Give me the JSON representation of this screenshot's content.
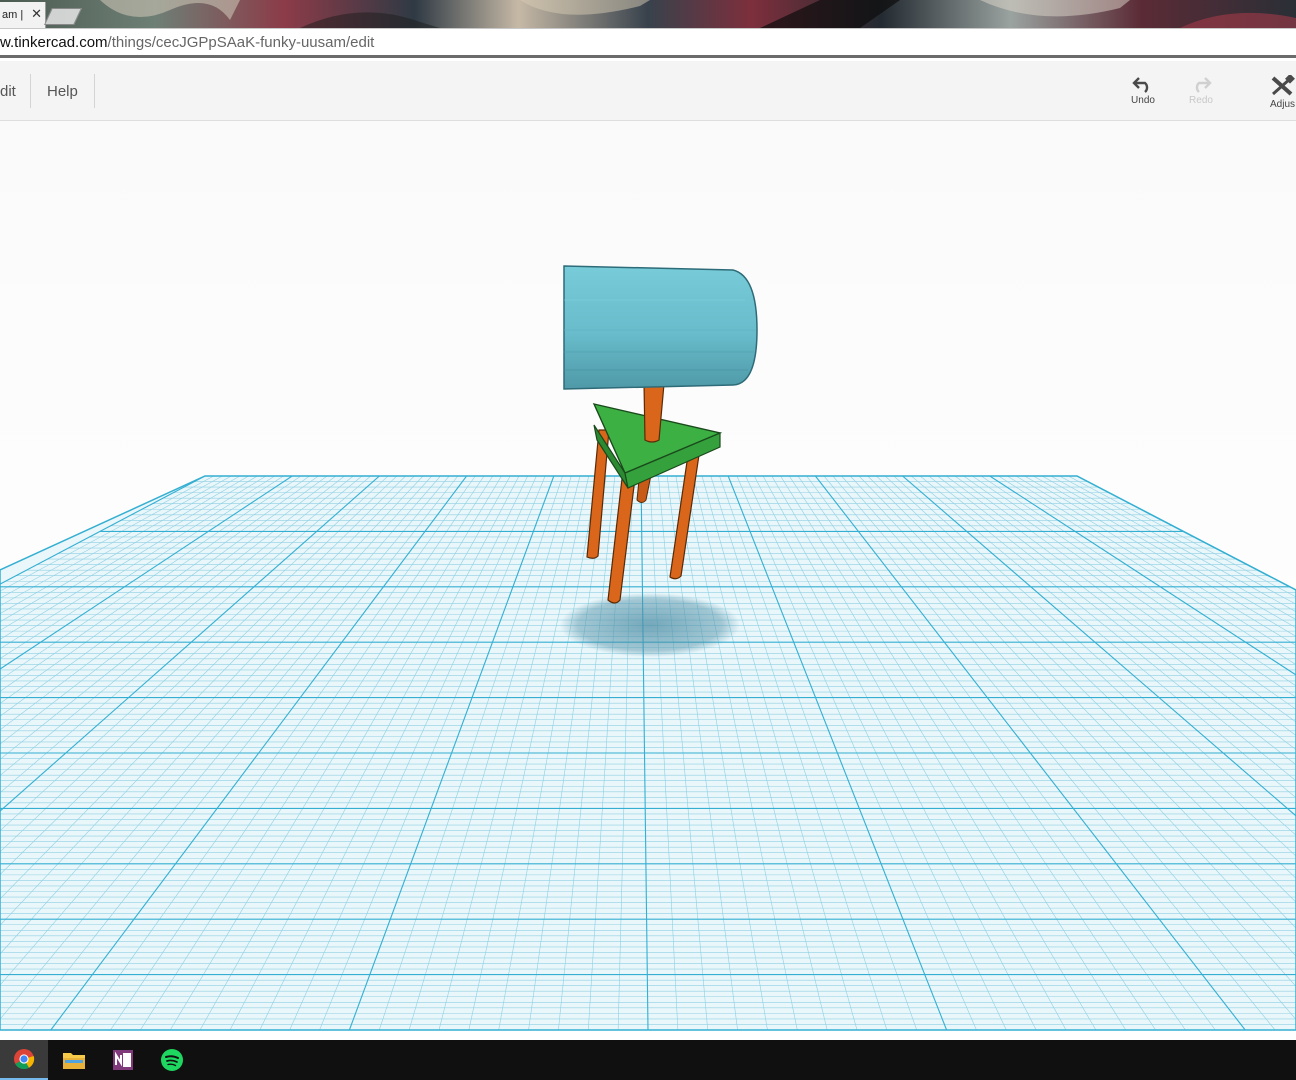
{
  "browser": {
    "tab": {
      "title": "am |",
      "close_glyph": "✕"
    },
    "address": {
      "domain": "w.tinkercad.com",
      "path": "/things/cecJGPpSAaK-funky-uusam/edit"
    }
  },
  "toolbar": {
    "menu": [
      {
        "label": "dit"
      },
      {
        "label": "Help"
      }
    ],
    "tools": {
      "undo": {
        "label": "Undo",
        "icon": "undo-icon",
        "enabled": true
      },
      "redo": {
        "label": "Redo",
        "icon": "redo-icon",
        "enabled": false
      },
      "adjust": {
        "label": "Adjus",
        "icon": "adjust-icon",
        "enabled": true
      }
    }
  },
  "scene": {
    "objects": [
      {
        "name": "cylinder-body",
        "color": "#6ec6d4"
      },
      {
        "name": "triangle-seat",
        "color": "#3cb043"
      },
      {
        "name": "legs",
        "color": "#d9661a"
      }
    ],
    "grid_color": "#34afd2"
  },
  "taskbar": {
    "apps": [
      {
        "icon": "chrome-icon",
        "active": true
      },
      {
        "icon": "file-explorer-icon",
        "active": false
      },
      {
        "icon": "onenote-icon",
        "active": false
      },
      {
        "icon": "spotify-icon",
        "active": false
      }
    ]
  }
}
